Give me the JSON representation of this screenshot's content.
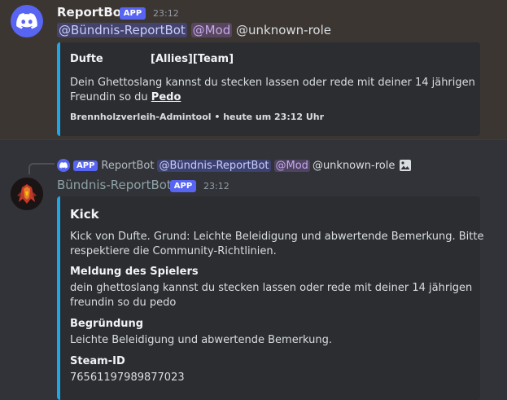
{
  "message1": {
    "author": "ReportBot",
    "badge": "APP",
    "time": "23:12",
    "mentions": [
      "@Bündnis-ReportBot",
      "@Mod",
      "@unknown-role"
    ],
    "embed": {
      "field_name": "Dufte",
      "field_value": "[Allies][Team]",
      "body_line1": "Dein Ghettoslang kannst du stecken lassen oder rede mit deiner 14 jährigen",
      "body_line2_prefix": "Freundin so du ",
      "body_line2_bold": "Pedo",
      "footer": "Brennholzverleih-Admintool • heute um 23:12 Uhr"
    }
  },
  "message2": {
    "reply": {
      "badge": "APP",
      "author": "ReportBot",
      "mentions": [
        "@Bündnis-ReportBot",
        "@Mod",
        "@unknown-role"
      ]
    },
    "author": "Bündnis-ReportBot",
    "badge": "APP",
    "time": "23:12",
    "embed": {
      "title": "Kick",
      "description_line1": "Kick von Dufte. Grund: Leichte Beleidigung und abwertende Bemerkung. Bitte",
      "description_line2": "respektiere die Community-Richtlinien.",
      "fields": [
        {
          "name": "Meldung des Spielers",
          "line1": "dein ghettoslang kannst du stecken lassen oder rede mit deiner 14 jährigen",
          "line2": "freundin so du pedo"
        },
        {
          "name": "Begründung",
          "line1": "Leichte Beleidigung und abwertende Bemerkung."
        },
        {
          "name": "Steam-ID",
          "line1": "76561197989877023"
        }
      ]
    }
  },
  "colors": {
    "background": "#313338",
    "highlight": "#3c3633",
    "embed_bg": "#2b2d31",
    "embed_accent": "#1ea7e6",
    "blurple": "#5865f2",
    "bot_name_2": "#8ea2a6"
  },
  "icons": [
    "discord-logo-icon",
    "discord-small-icon",
    "image-icon",
    "bot-avatar"
  ]
}
